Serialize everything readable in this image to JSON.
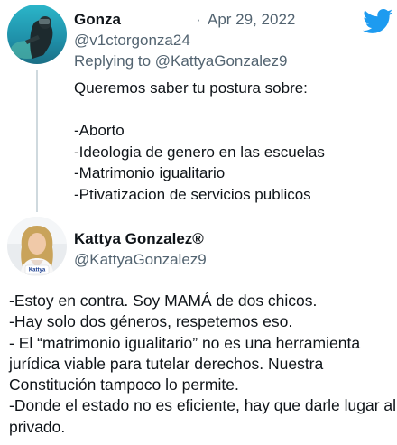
{
  "tweet": {
    "author_name": "Gonza",
    "author_handle": "@v1ctorgonza24",
    "separator": "·",
    "date": "Apr 29, 2022",
    "replying_to": "Replying to @KattyaGonzalez9",
    "lines": [
      "Queremos saber tu postura sobre:",
      "",
      "-Aborto",
      "-Ideologia de genero en las escuelas",
      "-Matrimonio igualitario",
      "-Ptivatizacion de servicios publicos"
    ]
  },
  "reply": {
    "author_name": "Kattya Gonzalez®",
    "author_handle": "@KattyaGonzalez9",
    "avatar_badge": "Kattya",
    "lines": [
      "-Estoy en contra. Soy MAMÁ de dos chicos.",
      "-Hay solo dos géneros, respetemos eso.",
      "- El “matrimonio igualitario” no es una herramienta",
      "jurídica viable para tutelar derechos. Nuestra",
      "Constitución tampoco lo permite.",
      "-Donde el estado no es eficiente, hay que darle lugar al",
      "privado."
    ]
  },
  "colors": {
    "twitter_blue": "#1d9bf0",
    "secondary_text": "#536471",
    "primary_text": "#0f1419",
    "thread_line": "#cfd9de"
  },
  "icons": {
    "brand": "twitter-bird-icon"
  }
}
